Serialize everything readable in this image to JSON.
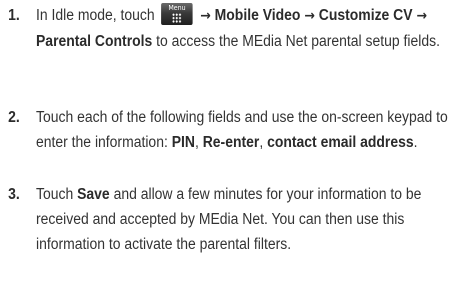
{
  "steps": [
    {
      "number": "1.",
      "intro": "In Idle mode, touch",
      "menu_key_label": "Menu",
      "arrow": "→",
      "path_1": "Mobile Video",
      "path_2": "Customize CV",
      "path_3": "Parental Controls",
      "tail": " to access the MEdia Net parental setup fields."
    },
    {
      "number": "2.",
      "intro": "Touch each of the following fields and use the on-screen keypad to enter the information: ",
      "field_1": "PIN",
      "sep_1": ", ",
      "field_2": "Re-enter",
      "sep_2": ", ",
      "field_3": "contact email address",
      "tail": "."
    },
    {
      "number": "3.",
      "intro": "Touch ",
      "action": "Save",
      "tail": " and allow a few minutes for your information to be received and accepted by MEdia Net. You can then use this information to activate the parental filters."
    }
  ]
}
